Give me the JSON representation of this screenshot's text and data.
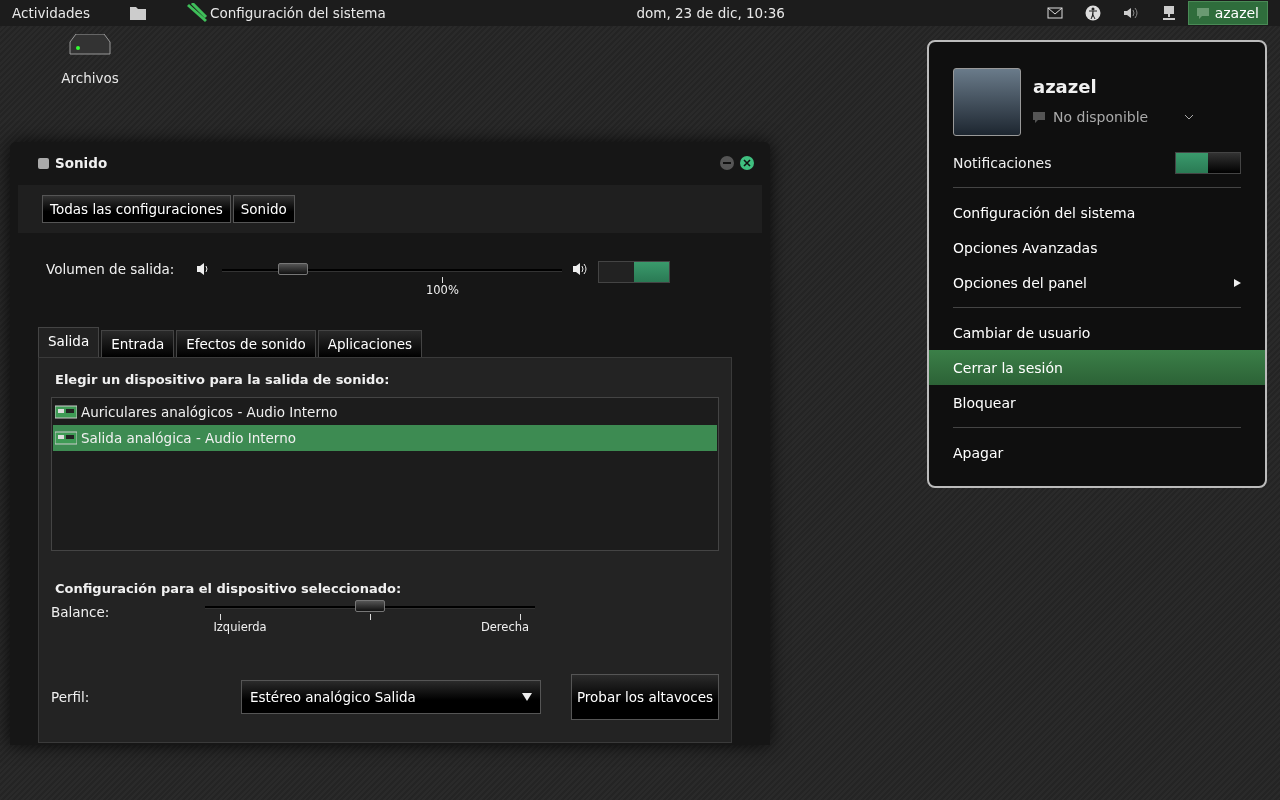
{
  "top_bar": {
    "activities": "Actividades",
    "app_name": "Configuración del sistema",
    "clock": "dom, 23 de dic, 10:36",
    "user": "azazel"
  },
  "desktop_icons": [
    {
      "label": "Archivos"
    }
  ],
  "window": {
    "title": "Sonido",
    "breadcrumbs": [
      "Todas las configuraciones",
      "Sonido"
    ],
    "volume": {
      "label": "Volumen de salida:",
      "level": 0.18,
      "reading": "100%",
      "on": true
    },
    "tabs": [
      {
        "label": "Salida",
        "selected": true
      },
      {
        "label": "Entrada",
        "selected": false
      },
      {
        "label": "Efectos de sonido",
        "selected": false
      },
      {
        "label": "Aplicaciones",
        "selected": false
      }
    ],
    "devices_heading": "Elegir un dispositivo para la salida de sonido:",
    "devices": [
      {
        "label": "Auriculares analógicos - Audio Interno",
        "selected": false
      },
      {
        "label": "Salida analógica - Audio Interno",
        "selected": true
      }
    ],
    "settings_heading": "Configuración para el dispositivo seleccionado:",
    "balance": {
      "label": "Balance:",
      "level": 0.5,
      "left": "Izquierda",
      "right": "Derecha"
    },
    "profile": {
      "label": "Perfil:",
      "value": "Estéreo analógico Salida"
    },
    "test_button": "Probar los altavoces"
  },
  "user_menu": {
    "name": "azazel",
    "status": "No disponible",
    "notifications": {
      "label": "Notificaciones",
      "on": true
    },
    "sections": [
      [
        {
          "label": "Configuración del sistema",
          "kind": "item",
          "selected": false
        },
        {
          "label": "Opciones Avanzadas",
          "kind": "item",
          "selected": false
        },
        {
          "label": "Opciones del panel",
          "kind": "submenu",
          "selected": false
        }
      ],
      [
        {
          "label": "Cambiar de usuario",
          "kind": "item",
          "selected": false
        },
        {
          "label": "Cerrar la sesión",
          "kind": "item",
          "selected": true
        },
        {
          "label": "Bloquear",
          "kind": "item",
          "selected": false
        }
      ],
      [
        {
          "label": "Apagar",
          "kind": "item",
          "selected": false
        }
      ]
    ]
  }
}
